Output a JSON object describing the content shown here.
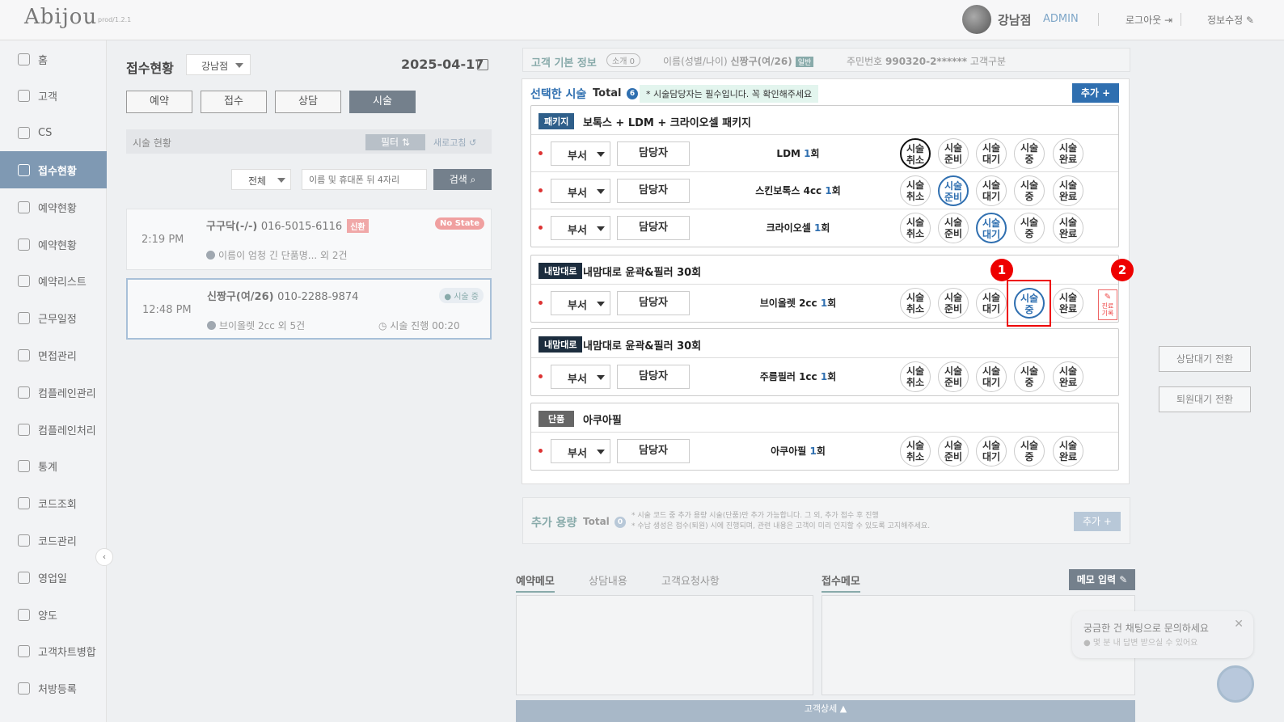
{
  "header": {
    "logo": "Abijou",
    "version": "prod/1.2.1",
    "store": "강남점",
    "role": "ADMIN",
    "logout": "로그아웃 ⇥",
    "edit_info": "정보수정 ✎"
  },
  "sidebar": {
    "items": [
      {
        "label": "홈",
        "icon": "home-icon"
      },
      {
        "label": "고객",
        "icon": "users-icon"
      },
      {
        "label": "CS",
        "icon": "cs-icon"
      },
      {
        "label": "접수현황",
        "icon": "reception-icon"
      },
      {
        "label": "예약현황",
        "icon": "calendar-icon"
      },
      {
        "label": "예약현황",
        "icon": "calendar-lock-icon"
      },
      {
        "label": "예약리스트",
        "icon": "list-icon"
      },
      {
        "label": "근무일정",
        "icon": "schedule-icon"
      },
      {
        "label": "면접관리",
        "icon": "interview-icon"
      },
      {
        "label": "컴플레인관리",
        "icon": "complaint-icon"
      },
      {
        "label": "컴플레인처리",
        "icon": "smile-icon"
      },
      {
        "label": "통계",
        "icon": "stats-icon"
      },
      {
        "label": "코드조회",
        "icon": "code-search-icon"
      },
      {
        "label": "코드관리",
        "icon": "code-manage-icon"
      },
      {
        "label": "영업일",
        "icon": "business-day-icon"
      },
      {
        "label": "양도",
        "icon": "transfer-icon"
      },
      {
        "label": "고객차트병합",
        "icon": "merge-icon"
      },
      {
        "label": "처방등록",
        "icon": "prescription-icon"
      }
    ],
    "active_index": 3
  },
  "left": {
    "title": "접수현황",
    "store_select": "강남점",
    "date": "2025-04-17",
    "tabs": [
      "예약",
      "접수",
      "상담",
      "시술"
    ],
    "active_tab": 3,
    "status_label": "시술 현황",
    "filter_label": "필터 ⇅",
    "refresh_label": "새로고침 ↺",
    "all_select": "전체",
    "search_placeholder": "이름 및 휴대폰 뒤 4자리",
    "search_btn": "검색 ⌕",
    "cards": [
      {
        "time": "2:19 PM",
        "name": "구구닥(-/-)",
        "phone": "016-5015-6116",
        "badge": "신환",
        "state": "No State",
        "sub": "이름이 엄청 긴 단품명... 외 2건"
      },
      {
        "time": "12:48 PM",
        "name": "신짱구(여/26)",
        "phone": "010-2288-9874",
        "state": "● 시술 중",
        "sub": "브이올렛 2cc 외 5건",
        "timer": "◷ 시술 진행 00:20"
      }
    ]
  },
  "info_bar": {
    "title": "고객 기본 정보",
    "intro": "소개 0",
    "name_label": "이름(성별/나이)",
    "name": "신짱구(여/26)",
    "grade": "일반",
    "jumin_label": "주민번호",
    "jumin": "990320-2******",
    "cust_type": "고객구분"
  },
  "modal": {
    "title": "선택한 시술",
    "total_label": "Total",
    "total": "6",
    "notice": "* 시술담당자는 필수입니다. 꼭 확인해주세요",
    "add": "추가 +",
    "dept_label": "부서",
    "staff_label": "담당자",
    "status_buttons": [
      "시술 취소",
      "시술 준비",
      "시술 대기",
      "시술 중",
      "시술 완료"
    ],
    "memo_label": "진료 기록",
    "groups": [
      {
        "tag": "패키지",
        "name": "보톡스 + LDM + 크라이오셀 패키지",
        "rows": [
          {
            "proc": "LDM",
            "count": "1",
            "unit": "회",
            "selected": 0
          },
          {
            "proc": "스킨보톡스 4cc",
            "count": "1",
            "unit": "회",
            "selected": 1
          },
          {
            "proc": "크라이오셀",
            "count": "1",
            "unit": "회",
            "selected": 2
          }
        ]
      },
      {
        "tag": "내맘대로",
        "name": "내맘대로 윤곽&필러 30회",
        "rows": [
          {
            "proc": "브이올렛 2cc",
            "count": "1",
            "unit": "회",
            "selected": 3
          }
        ]
      },
      {
        "tag": "내맘대로",
        "name": "내맘대로 윤곽&필러 30회",
        "rows": [
          {
            "proc": "주름필러 1cc",
            "count": "1",
            "unit": "회",
            "selected": -1
          }
        ]
      },
      {
        "tag": "단품",
        "name": "아쿠아필",
        "rows": [
          {
            "proc": "아쿠아필",
            "count": "1",
            "unit": "회",
            "selected": -1
          }
        ]
      }
    ],
    "callouts": [
      "1",
      "2"
    ]
  },
  "extra": {
    "title": "추가 용량",
    "total_label": "Total",
    "total": "0",
    "note1": "* 시술 코드 중 추가 용량 시술(단품)만 추가 가능합니다. 그 외, 추가 접수 후 진행",
    "note2": "* 수납 생성은 접수(퇴원) 시에 진행되며, 관련 내용은 고객이 미리 인지할 수 있도록 고지해주세요.",
    "add": "추가 +"
  },
  "memo": {
    "tabs": [
      "예약메모",
      "상담내용",
      "고객요청사항"
    ],
    "reception_tab": "접수메모",
    "input_btn": "메모 입력 ✎",
    "bottom_bar": "고객상세 ▲"
  },
  "side_buttons": [
    "상담대기 전환",
    "퇴원대기 전환"
  ],
  "chat": {
    "line1": "궁금한 건 채팅으로 문의하세요",
    "line2": "● 몇 분 내 답변 받으실 수 있어요",
    "close": "✕"
  }
}
